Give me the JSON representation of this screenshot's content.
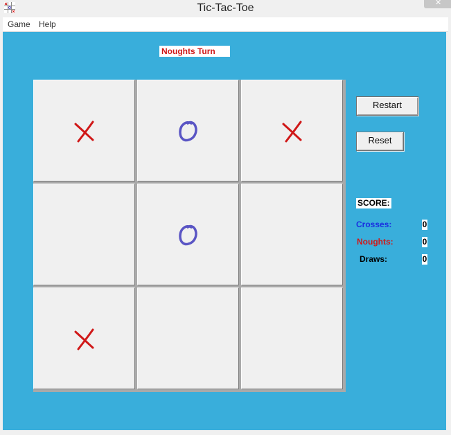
{
  "window": {
    "title": "Tic-Tac-Toe"
  },
  "menu": {
    "items": [
      "Game",
      "Help"
    ]
  },
  "status_text": "Noughts Turn",
  "board": [
    [
      "X",
      "O",
      "X"
    ],
    [
      "",
      "O",
      ""
    ],
    [
      "X",
      "",
      ""
    ]
  ],
  "buttons": {
    "restart": "Restart",
    "reset": "Reset"
  },
  "score": {
    "heading": "SCORE:",
    "crosses_label": "Crosses:",
    "noughts_label": "Noughts:",
    "draws_label": "Draws:",
    "crosses": "0",
    "noughts": "0",
    "draws": "0"
  },
  "colors": {
    "background": "#39aedb",
    "cross": "#d01818",
    "nought": "#5a55c4",
    "crosses_label": "#1a2fe0",
    "noughts_label": "#d01818"
  },
  "icons": {
    "app": "tic-tac-toe-app-icon",
    "close": "close-icon"
  }
}
